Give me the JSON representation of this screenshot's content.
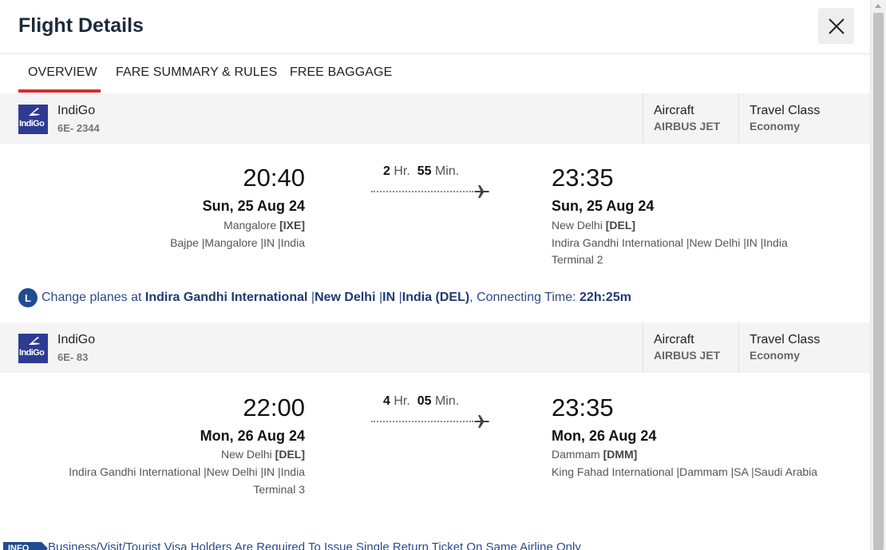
{
  "title": "Flight Details",
  "tabs": [
    {
      "label": "OVERVIEW",
      "active": true
    },
    {
      "label": "FARE SUMMARY & RULES",
      "active": false
    },
    {
      "label": "FREE BAGGAGE",
      "active": false
    }
  ],
  "segments": [
    {
      "airline": "IndiGo",
      "logo_text": "IndiGo",
      "flight_no": "6E- 2344",
      "aircraft_label": "Aircraft",
      "aircraft": "AIRBUS JET",
      "class_label": "Travel Class",
      "travel_class": "Economy",
      "depart": {
        "time": "20:40",
        "date": "Sun, 25 Aug 24",
        "city": "Mangalore",
        "code": "[IXE]",
        "airport": "Bajpe |Mangalore |IN |India",
        "terminal": ""
      },
      "duration": {
        "hours": "2",
        "hr_label": "Hr.",
        "mins": "55",
        "min_label": "Min."
      },
      "arrive": {
        "time": "23:35",
        "date": "Sun, 25 Aug 24",
        "city": "New Delhi",
        "code": "[DEL]",
        "airport": "Indira Gandhi International |New Delhi |IN |India",
        "terminal": "Terminal 2"
      }
    },
    {
      "airline": "IndiGo",
      "logo_text": "IndiGo",
      "flight_no": "6E- 83",
      "aircraft_label": "Aircraft",
      "aircraft": "AIRBUS JET",
      "class_label": "Travel Class",
      "travel_class": "Economy",
      "depart": {
        "time": "22:00",
        "date": "Mon, 26 Aug 24",
        "city": "New Delhi",
        "code": "[DEL]",
        "airport": "Indira Gandhi International |New Delhi |IN |India",
        "terminal": "Terminal 3"
      },
      "duration": {
        "hours": "4",
        "hr_label": "Hr.",
        "mins": "05",
        "min_label": "Min."
      },
      "arrive": {
        "time": "23:35",
        "date": "Mon, 26 Aug 24",
        "city": "Dammam",
        "code": "[DMM]",
        "airport": "King Fahad International |Dammam |SA |Saudi Arabia",
        "terminal": ""
      }
    }
  ],
  "layover": {
    "badge": "L",
    "prefix": "Change planes at ",
    "airport": "Indira Gandhi International",
    "sep1": " |",
    "city": "New Delhi",
    "sep2": " |",
    "country_code": "IN",
    "sep3": " |",
    "country": "India (DEL)",
    "mid": ", Connecting Time: ",
    "time": "22h:25m"
  },
  "info": {
    "tag": "INFO",
    "text": "Business/Visit/Tourist Visa Holders Are Required To Issue Single Return Ticket On Same Airline Only"
  },
  "icons": {
    "close": "close-icon",
    "plane": "plane-icon",
    "logo": "indigo-logo"
  },
  "colors": {
    "accent": "#d32f2f",
    "brand": "#2e3b93",
    "link": "#1f4d8f"
  }
}
